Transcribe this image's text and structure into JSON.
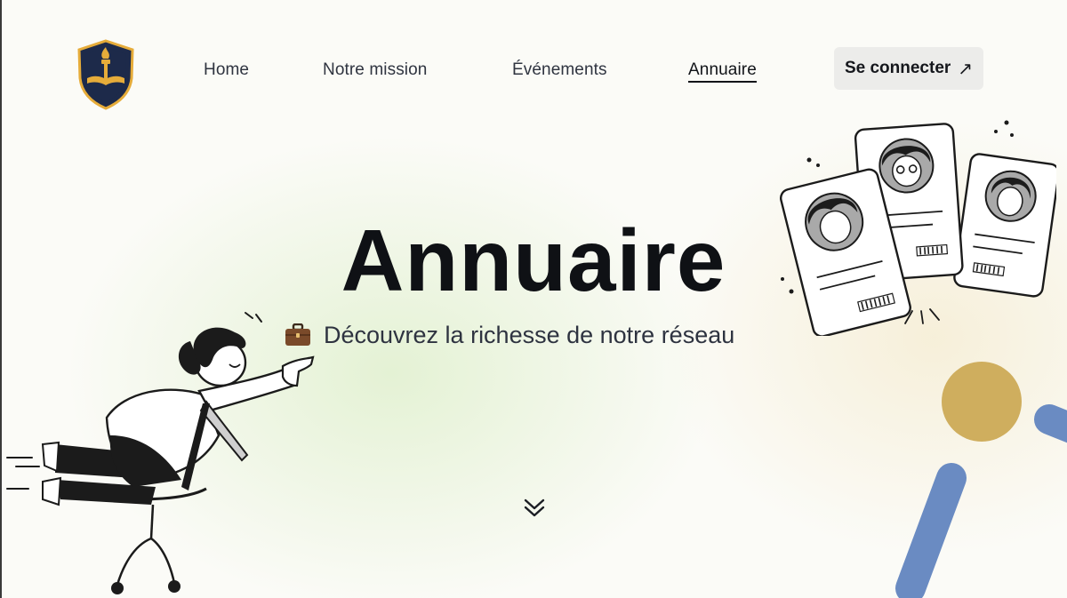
{
  "nav": {
    "logo_icon": "torch-shield-icon",
    "items": [
      {
        "label": "Home",
        "active": false
      },
      {
        "label": "Notre mission",
        "active": false
      },
      {
        "label": "Événements",
        "active": false
      },
      {
        "label": "Annuaire",
        "active": true
      }
    ],
    "login_label": "Se connecter",
    "login_icon": "arrow-up-right-icon"
  },
  "hero": {
    "title": "Annuaire",
    "subtitle": "Découvrez la richesse de notre réseau",
    "subtitle_icon": "briefcase-icon",
    "scroll_icon": "double-chevron-down-icon"
  },
  "colors": {
    "shield_navy": "#1d2a4a",
    "shield_gold": "#e6ac3a",
    "accent_gold": "#cfae5e",
    "accent_blue": "#6a8bc2",
    "text_dark": "#0f1115",
    "button_bg": "#ececea"
  }
}
